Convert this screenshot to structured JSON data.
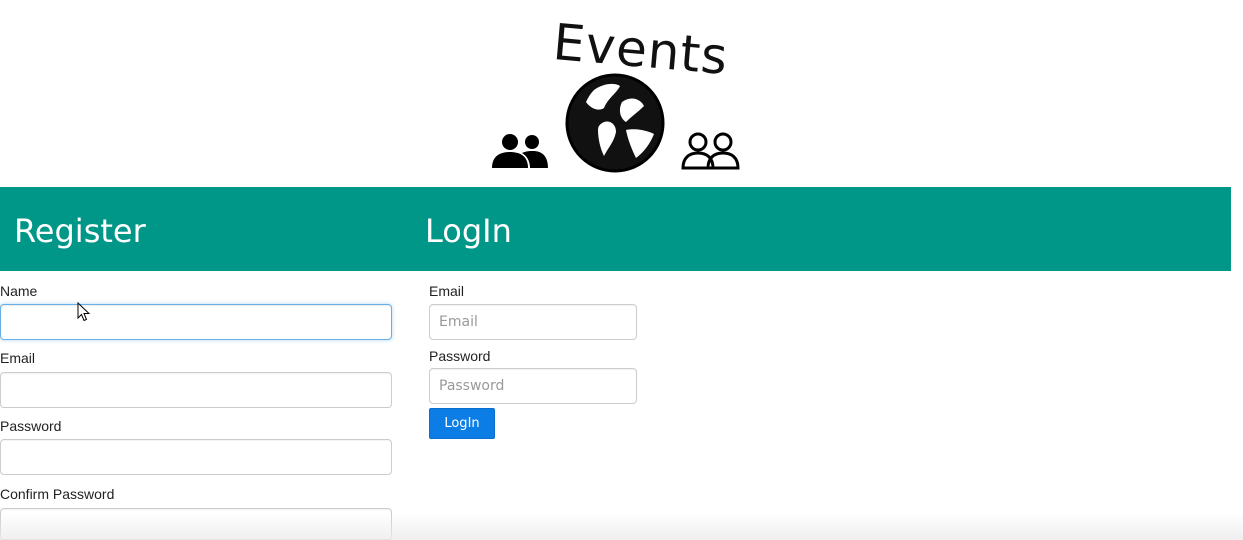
{
  "logo": {
    "title": "Events",
    "icons": [
      "people-filled-icon",
      "globe-icon",
      "people-outline-icon"
    ]
  },
  "header": {
    "register_heading": "Register",
    "login_heading": "LogIn",
    "band_color": "#009688"
  },
  "register_form": {
    "name_label": "Name",
    "name_value": "",
    "email_label": "Email",
    "email_value": "",
    "password_label": "Password",
    "password_value": "",
    "confirm_password_label": "Confirm Password",
    "confirm_password_value": ""
  },
  "login_form": {
    "email_label": "Email",
    "email_placeholder": "Email",
    "password_label": "Password",
    "password_placeholder": "Password",
    "submit_label": "LogIn",
    "submit_color": "#0d7de6"
  }
}
